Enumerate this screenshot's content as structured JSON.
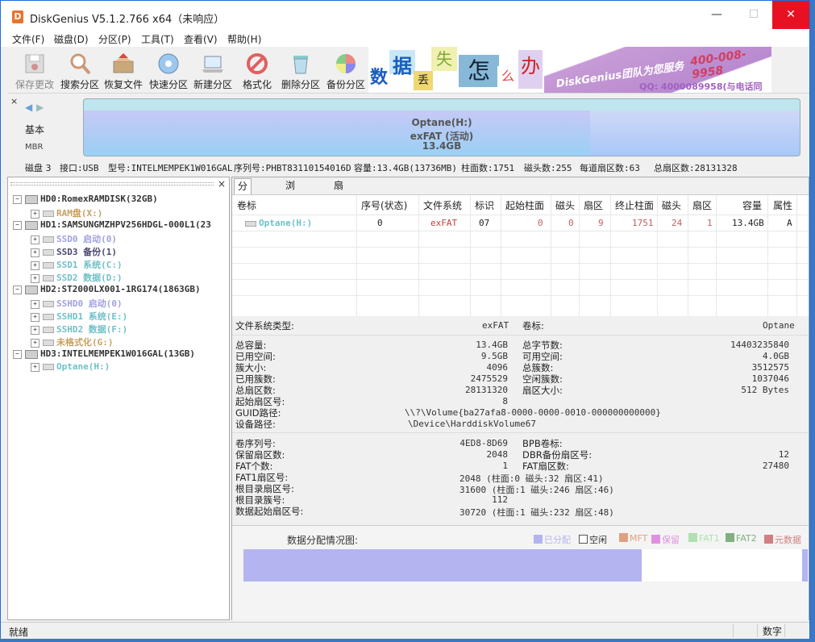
{
  "title": "DiskGenius V5.1.2.766 x64（未响应）",
  "menu": [
    "文件(F)",
    "磁盘(D)",
    "分区(P)",
    "工具(T)",
    "查看(V)",
    "帮助(H)"
  ],
  "toolbar": [
    {
      "label": "保存更改",
      "icon": "save-icon",
      "enabled": false
    },
    {
      "label": "搜索分区",
      "icon": "magnifier-icon",
      "enabled": true
    },
    {
      "label": "恢复文件",
      "icon": "box-icon",
      "enabled": true
    },
    {
      "label": "快速分区",
      "icon": "disc-icon",
      "enabled": true
    },
    {
      "label": "新建分区",
      "icon": "laptop-icon",
      "enabled": true
    },
    {
      "label": "格式化",
      "icon": "forbid-icon",
      "enabled": true
    },
    {
      "label": "删除分区",
      "icon": "trash-icon",
      "enabled": true
    },
    {
      "label": "备份分区",
      "icon": "pie-icon",
      "enabled": true
    }
  ],
  "banner": {
    "chars": [
      "数",
      "据",
      "丢",
      "失",
      "怎",
      "么",
      "办"
    ],
    "brand": "DiskGenius团队为您服务",
    "phone": "400-008-9958",
    "qq": "QQ: 4000089958(与电话同号)"
  },
  "diskbar": {
    "mode": "基本",
    "type": "MBR",
    "part_name": "Optane(H:)",
    "part_fs": "exFAT (活动)",
    "part_size": "13.4GB"
  },
  "diskinfo": {
    "disk": "磁盘 3",
    "iface": "接口:USB",
    "model": "型号:INTELMEMPEK1W016GAL",
    "serial": "序列号:PHBT83110154016D",
    "capacity": "容量:13.4GB(13736MB)",
    "cylinders": "柱面数:1751",
    "heads": "磁头数:255",
    "sectors": "每道扇区数:63",
    "total": "总扇区数:28131328"
  },
  "tree": [
    {
      "level": 0,
      "text": "HD0:RomexRAMDISK(32GB)",
      "color": "#333333",
      "type": "disk"
    },
    {
      "level": 1,
      "text": "RAM盘(X:)",
      "color": "#c8a060",
      "type": "part"
    },
    {
      "level": 0,
      "text": "HD1:SAMSUNGMZHPV256HDGL-000L1(23",
      "color": "#333333",
      "type": "disk"
    },
    {
      "level": 1,
      "text": "SSD0 启动(0)",
      "color": "#a0a0e0",
      "type": "part"
    },
    {
      "level": 1,
      "text": "SSD3 备份(1)",
      "color": "#4a4a70",
      "type": "part"
    },
    {
      "level": 1,
      "text": "SSD1 系统(C:)",
      "color": "#70c0c8",
      "type": "part"
    },
    {
      "level": 1,
      "text": "SSD2 数据(D:)",
      "color": "#70c0c8",
      "type": "part"
    },
    {
      "level": 0,
      "text": "HD2:ST2000LX001-1RG174(1863GB)",
      "color": "#333333",
      "type": "disk"
    },
    {
      "level": 1,
      "text": "SSHD0 启动(0)",
      "color": "#a0a0e0",
      "type": "part"
    },
    {
      "level": 1,
      "text": "SSHD1 系统(E:)",
      "color": "#70c0c8",
      "type": "part"
    },
    {
      "level": 1,
      "text": "SSHD2 数据(F:)",
      "color": "#70c0c8",
      "type": "part"
    },
    {
      "level": 1,
      "text": "未格式化(G:)",
      "color": "#c8a060",
      "type": "part"
    },
    {
      "level": 0,
      "text": "HD3:INTELMEMPEK1W016GAL(13GB)",
      "color": "#333333",
      "type": "disk"
    },
    {
      "level": 1,
      "text": "Optane(H:)",
      "color": "#70c0c8",
      "type": "part"
    }
  ],
  "tabs": [
    "分区参数",
    "浏览文件",
    "扇区编辑"
  ],
  "grid": {
    "headers": [
      "卷标",
      "序号(状态)",
      "文件系统",
      "标识",
      "起始柱面",
      "磁头",
      "扇区",
      "终止柱面",
      "磁头",
      "扇区",
      "容量",
      "属性"
    ],
    "row": [
      "Optane(H:)",
      "0",
      "exFAT",
      "07",
      "0",
      "0",
      "9",
      "1751",
      "24",
      "1",
      "13.4GB",
      "A"
    ]
  },
  "fsinfo": {
    "fs_type_label": "文件系统类型:",
    "fs_type": "exFAT",
    "vol_label_label": "卷标:",
    "vol_label": "Optane",
    "left": [
      {
        "k": "总容量:",
        "v": "13.4GB"
      },
      {
        "k": "已用空间:",
        "v": "9.5GB"
      },
      {
        "k": "簇大小:",
        "v": "4096"
      },
      {
        "k": "已用簇数:",
        "v": "2475529"
      },
      {
        "k": "总扇区数:",
        "v": "28131320"
      },
      {
        "k": "起始扇区号:",
        "v": "8"
      }
    ],
    "right": [
      {
        "k": "总字节数:",
        "v": "14403235840"
      },
      {
        "k": "可用空间:",
        "v": "4.0GB"
      },
      {
        "k": "总簇数:",
        "v": "3512575"
      },
      {
        "k": "空闲簇数:",
        "v": "1037046"
      },
      {
        "k": "扇区大小:",
        "v": "512 Bytes"
      }
    ],
    "guid_label": "GUID路径:",
    "guid": "\\\\?\\Volume{ba27afa8-0000-0000-0010-000000000000}",
    "dev_label": "设备路径:",
    "dev": "\\Device\\HarddiskVolume67"
  },
  "bootinfo": {
    "left": [
      {
        "k": "卷序列号:",
        "v": "4ED8-8D69"
      },
      {
        "k": "保留扇区数:",
        "v": "2048"
      },
      {
        "k": "FAT个数:",
        "v": "1"
      },
      {
        "k": "FAT1扇区号:",
        "v": "2048 (柱面:0 磁头:32 扇区:41)"
      },
      {
        "k": "根目录扇区号:",
        "v": "31600 (柱面:1 磁头:246 扇区:46)"
      },
      {
        "k": "根目录簇号:",
        "v": "112"
      },
      {
        "k": "数据起始扇区号:",
        "v": "30720 (柱面:1 磁头:232 扇区:48)"
      }
    ],
    "right": [
      {
        "k": "BPB卷标:",
        "v": ""
      },
      {
        "k": "DBR备份扇区号:",
        "v": "12"
      },
      {
        "k": "FAT扇区数:",
        "v": "27480"
      }
    ]
  },
  "alloc": {
    "title": "数据分配情况图:",
    "legend": [
      {
        "label": "已分配",
        "color": "#b4b4f0"
      },
      {
        "label": "空闲",
        "color": "#ffffff"
      },
      {
        "label": "MFT",
        "color": "#e0a080"
      },
      {
        "label": "保留",
        "color": "#e090e0"
      },
      {
        "label": "FAT1",
        "color": "#b0e0b0"
      },
      {
        "label": "FAT2",
        "color": "#80b080"
      },
      {
        "label": "元数据",
        "color": "#d08080"
      }
    ],
    "used_fraction": 0.705
  },
  "status": {
    "text": "就绪",
    "mode": "数字"
  }
}
